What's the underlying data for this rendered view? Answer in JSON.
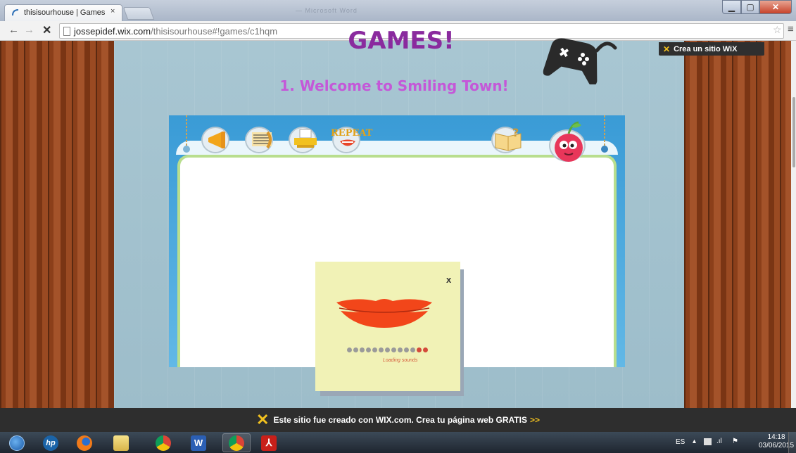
{
  "browser": {
    "tab_title": "thisisourhouse | Games",
    "tab_close": "×",
    "url_host": "jossepidef.wix.com",
    "url_path": "/thisisourhouse#!games/c1hqm",
    "window_title_hint": "— Microsoft Word",
    "back_glyph": "←",
    "forward_glyph": "→",
    "stop_glyph": "✕",
    "star_glyph": "☆",
    "menu_glyph": "≡"
  },
  "page": {
    "wix_badge": "Crea un sitio WiX",
    "title": "GAMES!",
    "subtitle": "1. Welcome to Smiling Town!",
    "repeat_label": "REPEAT",
    "card_close": "x",
    "loading_text": "Loading sounds",
    "loading_dots_total": 13,
    "loading_dots_active": 2
  },
  "footer": {
    "text": "Este sitio fue creado con WIX.com. Crea tu página web GRATIS",
    "arrows": ">>"
  },
  "taskbar": {
    "lang": "ES",
    "time": "14:18",
    "date": "03/06/2015",
    "apps": [
      "start-orb",
      "hp-icon",
      "firefox-icon",
      "file-explorer-icon",
      "chrome-icon",
      "word-icon",
      "chrome-icon",
      "acrobat-icon"
    ]
  },
  "colors": {
    "title": "#8a2a9e",
    "subtitle": "#c458d8",
    "frame": "#3a9bd6",
    "lips": "#f2461a"
  }
}
